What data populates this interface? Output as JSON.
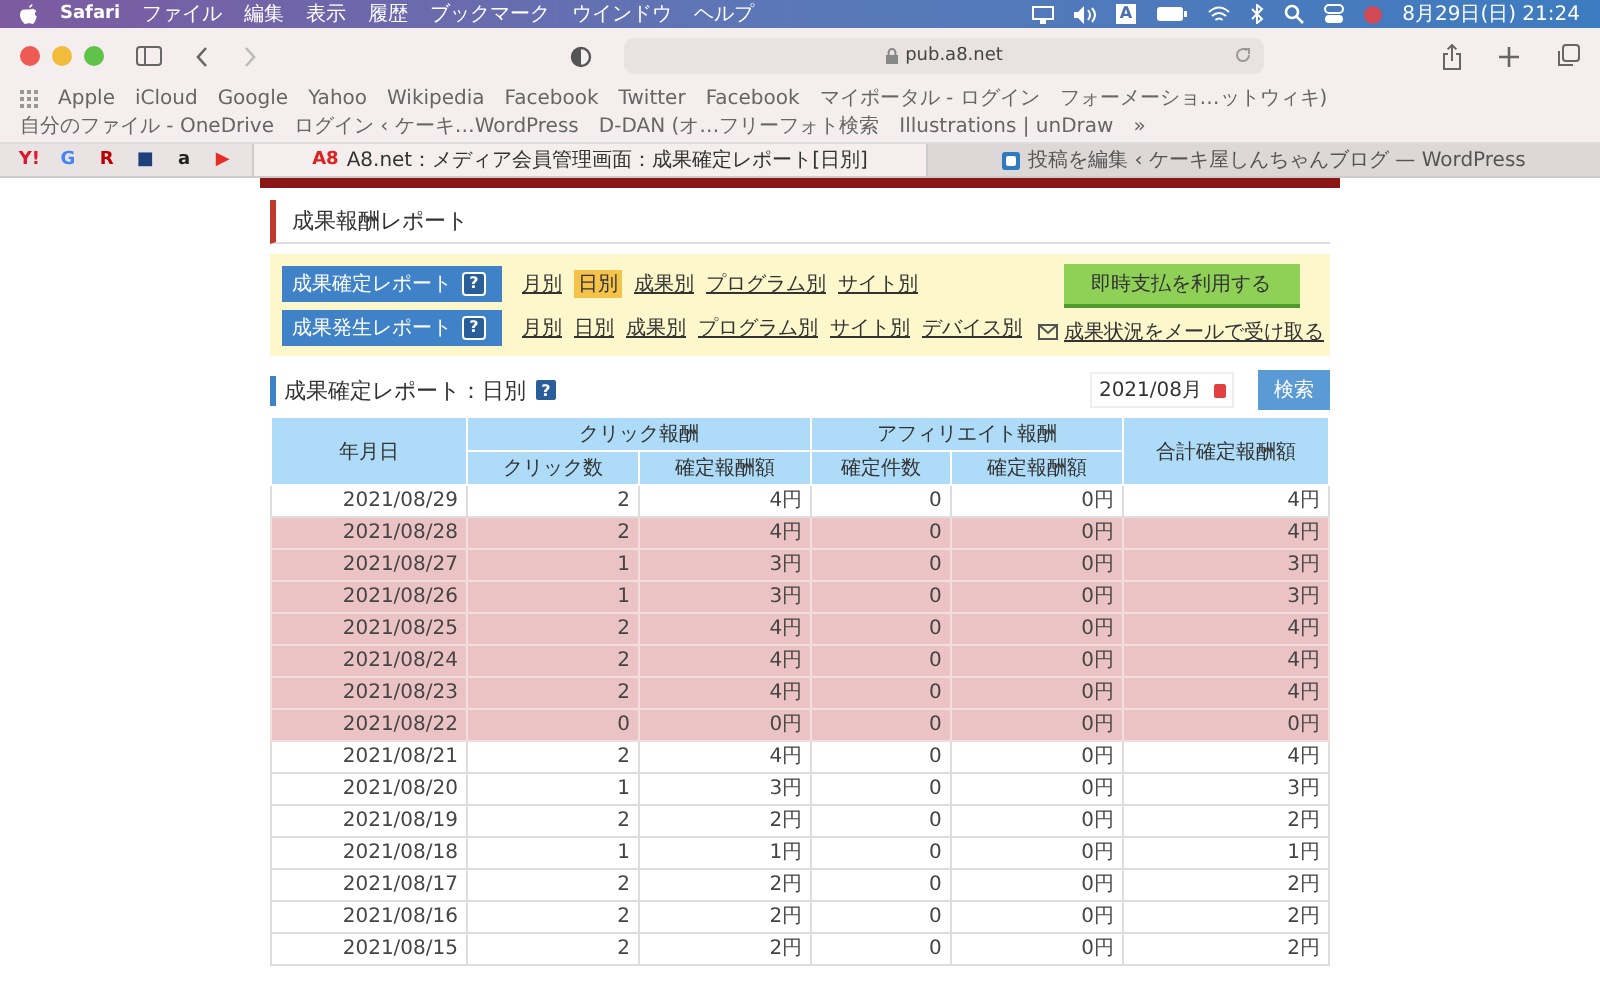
{
  "menubar": {
    "app": "Safari",
    "items": [
      "ファイル",
      "編集",
      "表示",
      "履歴",
      "ブックマーク",
      "ウインドウ",
      "ヘルプ"
    ],
    "input_indicator": "A",
    "clock": "8月29日(日) 21:24"
  },
  "toolbar": {
    "url": "pub.a8.net"
  },
  "bookmarks": [
    "Apple",
    "iCloud",
    "Google",
    "Yahoo",
    "Wikipedia",
    "Facebook",
    "Twitter",
    "Facebook",
    "マイポータル - ログイン",
    "フォーメーショ…ットウィキ)",
    "自分のファイル - OneDrive",
    "ログイン ‹ ケーキ…WordPress",
    "D-DAN (オ…フリーフォト検索",
    "Illustrations | unDraw"
  ],
  "bookmarks_more": "»",
  "pinned_tabs": [
    {
      "label": "Y!",
      "color": "#e0182c"
    },
    {
      "label": "G",
      "color": "#4285f4"
    },
    {
      "label": "R",
      "color": "#bf0000"
    },
    {
      "label": "■",
      "color": "#1d3f7a"
    },
    {
      "label": "a",
      "color": "#222222"
    },
    {
      "label": "▶",
      "color": "#e52d27"
    }
  ],
  "tabs": [
    {
      "title": "A8.net：メディア会員管理画面：成果確定レポート[日別]",
      "icon": "A8",
      "selected": true
    },
    {
      "title": "投稿を編集 ‹ ケーキ屋しんちゃんブログ — WordPress",
      "selected": false
    }
  ],
  "page": {
    "title": "成果報酬レポート",
    "report_nav": [
      {
        "label": "成果確定レポート",
        "help": "?",
        "links": [
          {
            "label": "月別",
            "selected": false
          },
          {
            "label": "日別",
            "selected": true
          },
          {
            "label": "成果別",
            "selected": false
          },
          {
            "label": "プログラム別",
            "selected": false
          },
          {
            "label": "サイト別",
            "selected": false
          }
        ]
      },
      {
        "label": "成果発生レポート",
        "help": "?",
        "links": [
          {
            "label": "月別",
            "selected": false
          },
          {
            "label": "日別",
            "selected": false
          },
          {
            "label": "成果別",
            "selected": false
          },
          {
            "label": "プログラム別",
            "selected": false
          },
          {
            "label": "サイト別",
            "selected": false
          },
          {
            "label": "デバイス別",
            "selected": false
          }
        ]
      }
    ],
    "instant_pay_button": "即時支払を利用する",
    "mail_link": "成果状況をメールで受け取る",
    "section_title": "成果確定レポート：日別",
    "section_help": "?",
    "month_select": "2021/08月",
    "search_button": "検索",
    "table": {
      "date_header": "年月日",
      "groups": [
        {
          "label": "クリック報酬",
          "columns": [
            "クリック数",
            "確定報酬額"
          ]
        },
        {
          "label": "アフィリエイト報酬",
          "columns": [
            "確定件数",
            "確定報酬額"
          ]
        }
      ],
      "total_header": "合計確定報酬額",
      "rows": [
        {
          "date": "2021/08/29",
          "cells": [
            "2",
            "4円",
            "0",
            "0円",
            "4円"
          ],
          "highlighted": false
        },
        {
          "date": "2021/08/28",
          "cells": [
            "2",
            "4円",
            "0",
            "0円",
            "4円"
          ],
          "highlighted": true
        },
        {
          "date": "2021/08/27",
          "cells": [
            "1",
            "3円",
            "0",
            "0円",
            "3円"
          ],
          "highlighted": true
        },
        {
          "date": "2021/08/26",
          "cells": [
            "1",
            "3円",
            "0",
            "0円",
            "3円"
          ],
          "highlighted": true
        },
        {
          "date": "2021/08/25",
          "cells": [
            "2",
            "4円",
            "0",
            "0円",
            "4円"
          ],
          "highlighted": true
        },
        {
          "date": "2021/08/24",
          "cells": [
            "2",
            "4円",
            "0",
            "0円",
            "4円"
          ],
          "highlighted": true
        },
        {
          "date": "2021/08/23",
          "cells": [
            "2",
            "4円",
            "0",
            "0円",
            "4円"
          ],
          "highlighted": true
        },
        {
          "date": "2021/08/22",
          "cells": [
            "0",
            "0円",
            "0",
            "0円",
            "0円"
          ],
          "highlighted": true
        },
        {
          "date": "2021/08/21",
          "cells": [
            "2",
            "4円",
            "0",
            "0円",
            "4円"
          ],
          "highlighted": false
        },
        {
          "date": "2021/08/20",
          "cells": [
            "1",
            "3円",
            "0",
            "0円",
            "3円"
          ],
          "highlighted": false
        },
        {
          "date": "2021/08/19",
          "cells": [
            "2",
            "2円",
            "0",
            "0円",
            "2円"
          ],
          "highlighted": false
        },
        {
          "date": "2021/08/18",
          "cells": [
            "1",
            "1円",
            "0",
            "0円",
            "1円"
          ],
          "highlighted": false
        },
        {
          "date": "2021/08/17",
          "cells": [
            "2",
            "2円",
            "0",
            "0円",
            "2円"
          ],
          "highlighted": false
        },
        {
          "date": "2021/08/16",
          "cells": [
            "2",
            "2円",
            "0",
            "0円",
            "2円"
          ],
          "highlighted": false
        },
        {
          "date": "2021/08/15",
          "cells": [
            "2",
            "2円",
            "0",
            "0円",
            "2円"
          ],
          "highlighted": false
        }
      ]
    }
  }
}
